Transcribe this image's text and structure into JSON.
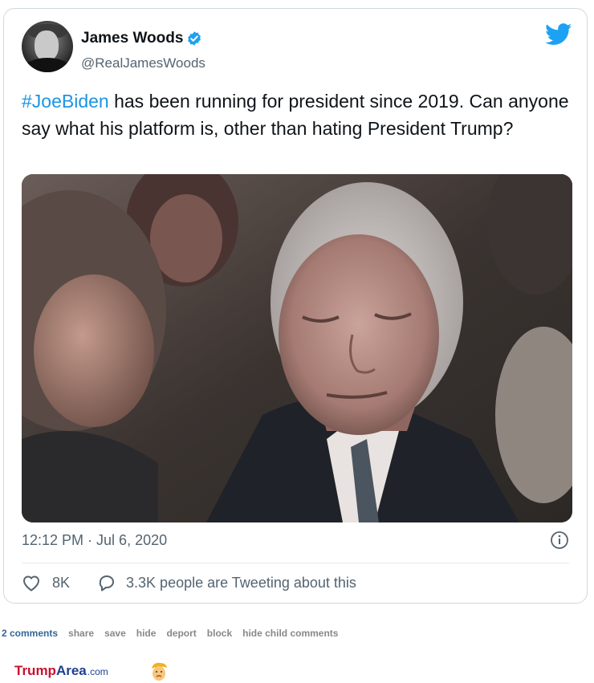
{
  "tweet": {
    "author_name": "James Woods",
    "author_handle": "@RealJamesWoods",
    "hashtag": "#JoeBiden",
    "body_text": " has been running for president since 2019. Can anyone say what his platform is, other than hating President Trump?",
    "timestamp": "12:12 PM · Jul 6, 2020",
    "like_count": "8K",
    "conversation_text": "3.3K people are Tweeting about this",
    "accent_color": "#1DA1F2"
  },
  "footer": {
    "comments_label": "2 comments",
    "links": [
      "share",
      "save",
      "hide",
      "deport",
      "block",
      "hide child comments"
    ]
  },
  "brand": {
    "part1": "Trump",
    "part2": "Area",
    "part3": ".com"
  },
  "icons": {
    "verified": "verified-badge-icon",
    "bird": "twitter-bird-icon",
    "info": "info-icon",
    "like": "heart-icon",
    "reply": "speech-bubble-icon",
    "mascot": "trump-mascot-icon"
  }
}
